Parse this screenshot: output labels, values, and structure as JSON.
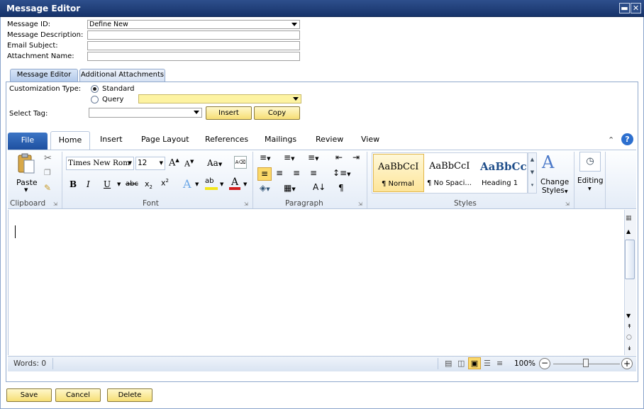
{
  "window": {
    "title": "Message Editor"
  },
  "form": {
    "message_id_label": "Message ID:",
    "message_id_value": "Define New",
    "message_description_label": "Message Description:",
    "email_subject_label": "Email Subject:",
    "attachment_name_label": "Attachment Name:"
  },
  "tabs": {
    "message_editor": "Message Editor",
    "additional_attachments": "Additional Attachments"
  },
  "customization": {
    "type_label": "Customization Type:",
    "standard_label": "Standard",
    "query_label": "Query",
    "select_tag_label": "Select Tag:",
    "insert_label": "Insert",
    "copy_label": "Copy"
  },
  "ribbon": {
    "tabs": [
      "File",
      "Home",
      "Insert",
      "Page Layout",
      "References",
      "Mailings",
      "Review",
      "View"
    ],
    "paste_label": "Paste",
    "font_name": "Times New Rom",
    "font_size": "12",
    "groups": {
      "clipboard": "Clipboard",
      "font": "Font",
      "paragraph": "Paragraph",
      "styles": "Styles"
    },
    "styles": [
      {
        "preview": "AaBbCcI",
        "name": "¶ Normal"
      },
      {
        "preview": "AaBbCcI",
        "name": "¶ No Spaci..."
      },
      {
        "preview": "AaBbCc",
        "name": "Heading 1"
      }
    ],
    "change_styles_line1": "Change",
    "change_styles_line2": "Styles",
    "editing_label": "Editing"
  },
  "status": {
    "words": "Words: 0",
    "zoom": "100%"
  },
  "buttons": {
    "save": "Save",
    "cancel": "Cancel",
    "delete": "Delete"
  }
}
